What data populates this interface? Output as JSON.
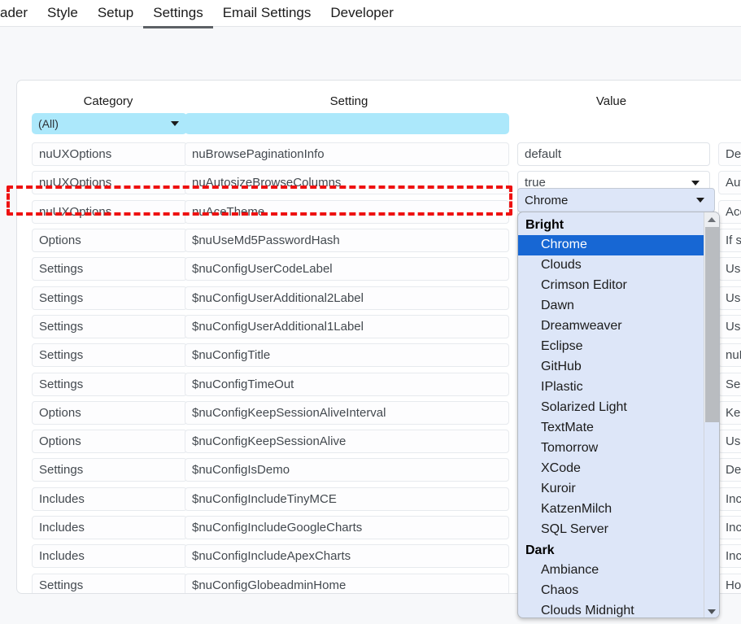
{
  "nav": {
    "tabs": [
      {
        "label": "ader",
        "active": false,
        "clipped": true
      },
      {
        "label": "Style",
        "active": false
      },
      {
        "label": "Setup",
        "active": false
      },
      {
        "label": "Settings",
        "active": true
      },
      {
        "label": "Email Settings",
        "active": false
      },
      {
        "label": "Developer",
        "active": false
      }
    ]
  },
  "table": {
    "columns": [
      {
        "key": "category",
        "label": "Category"
      },
      {
        "key": "setting",
        "label": "Setting"
      },
      {
        "key": "value",
        "label": "Value"
      }
    ],
    "filters": {
      "category": {
        "value": "(All)",
        "type": "select"
      },
      "setting": {
        "value": "",
        "placeholder": "",
        "type": "text"
      }
    },
    "rows": [
      {
        "category": "nuUXOptions",
        "setting": "nuBrowsePaginationInfo",
        "value": "default",
        "control": "text",
        "description": "Def"
      },
      {
        "category": "nuUXOptions",
        "setting": "nuAutosizeBrowseColumns",
        "value": "true",
        "control": "select",
        "description": "Aut"
      },
      {
        "category": "nuUXOptions",
        "setting": "nuAceTheme",
        "value": "Chrome",
        "control": "select",
        "description": "Ace",
        "highlighted": true
      },
      {
        "category": "Options",
        "setting": "$nuUseMd5PasswordHash",
        "value": "",
        "control": "text",
        "description": "If s"
      },
      {
        "category": "Settings",
        "setting": "$nuConfigUserCodeLabel",
        "value": "",
        "control": "text",
        "description": "Use"
      },
      {
        "category": "Settings",
        "setting": "$nuConfigUserAdditional2Label",
        "value": "",
        "control": "text",
        "description": "Use"
      },
      {
        "category": "Settings",
        "setting": "$nuConfigUserAdditional1Label",
        "value": "",
        "control": "text",
        "description": "Use"
      },
      {
        "category": "Settings",
        "setting": "$nuConfigTitle",
        "value": "",
        "control": "text",
        "description": "nuB"
      },
      {
        "category": "Settings",
        "setting": "$nuConfigTimeOut",
        "value": "",
        "control": "text",
        "description": "Ses"
      },
      {
        "category": "Options",
        "setting": "$nuConfigKeepSessionAliveInterval",
        "value": "",
        "control": "text",
        "description": "Kee"
      },
      {
        "category": "Options",
        "setting": "$nuConfigKeepSessionAlive",
        "value": "",
        "control": "text",
        "description": "Use"
      },
      {
        "category": "Settings",
        "setting": "$nuConfigIsDemo",
        "value": "",
        "control": "text",
        "description": "Dem"
      },
      {
        "category": "Includes",
        "setting": "$nuConfigIncludeTinyMCE",
        "value": "",
        "control": "text",
        "description": "Incl"
      },
      {
        "category": "Includes",
        "setting": "$nuConfigIncludeGoogleCharts",
        "value": "",
        "control": "text",
        "description": "Incl"
      },
      {
        "category": "Includes",
        "setting": "$nuConfigIncludeApexCharts",
        "value": "",
        "control": "text",
        "description": "Incl"
      },
      {
        "category": "Settings",
        "setting": "$nuConfigGlobeadminHome",
        "value": "",
        "control": "text",
        "description": "Hom"
      }
    ]
  },
  "dropdown": {
    "open": true,
    "selected": "Chrome",
    "groups": [
      {
        "label": "Bright",
        "options": [
          "Chrome",
          "Clouds",
          "Crimson Editor",
          "Dawn",
          "Dreamweaver",
          "Eclipse",
          "GitHub",
          "IPlastic",
          "Solarized Light",
          "TextMate",
          "Tomorrow",
          "XCode",
          "Kuroir",
          "KatzenMilch",
          "SQL Server"
        ]
      },
      {
        "label": "Dark",
        "options": [
          "Ambiance",
          "Chaos",
          "Clouds Midnight"
        ]
      }
    ],
    "scrollbar": {
      "up_icon": "caret-up-icon",
      "down_icon": "caret-down-icon"
    }
  },
  "colors": {
    "filter_bg": "#ace8fb",
    "highlight_border": "#ee1111",
    "selection_blue": "#1767d4",
    "dropdown_bg": "#dde6f8",
    "page_bg": "#f7f8fa"
  }
}
